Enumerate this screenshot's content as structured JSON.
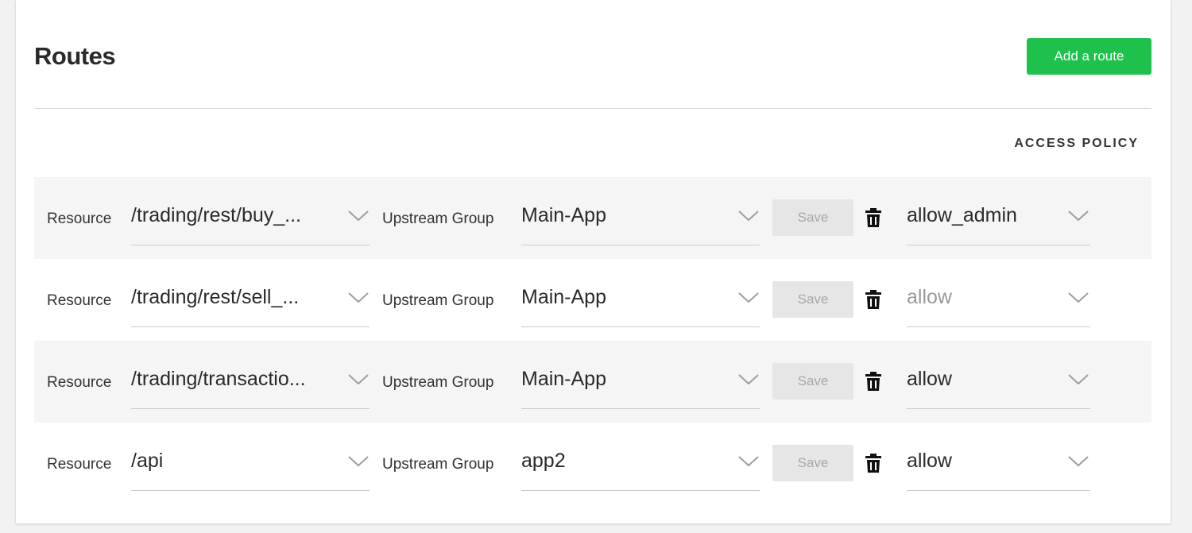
{
  "header": {
    "title": "Routes",
    "add_button_label": "Add a route",
    "access_policy_header": "ACCESS POLICY"
  },
  "colors": {
    "accent": "#1fc14d",
    "row_shade": "#f5f5f5",
    "save_disabled_bg": "#e6e6e6"
  },
  "icons": {
    "dropdown": "chevron-down-icon",
    "delete": "trash-icon"
  },
  "routes": [
    {
      "resource_label": "Resource",
      "resource_value": "/trading/rest/buy_...",
      "upstream_label": "Upstream Group",
      "upstream_value": "Main-App",
      "save_label": "Save",
      "policy_value": "allow_admin"
    },
    {
      "resource_label": "Resource",
      "resource_value": "/trading/rest/sell_...",
      "upstream_label": "Upstream Group",
      "upstream_value": "Main-App",
      "save_label": "Save",
      "policy_value": "allow"
    },
    {
      "resource_label": "Resource",
      "resource_value": "/trading/transactio...",
      "upstream_label": "Upstream Group",
      "upstream_value": "Main-App",
      "save_label": "Save",
      "policy_value": "allow"
    },
    {
      "resource_label": "Resource",
      "resource_value": "/api",
      "upstream_label": "Upstream Group",
      "upstream_value": "app2",
      "save_label": "Save",
      "policy_value": "allow"
    }
  ]
}
